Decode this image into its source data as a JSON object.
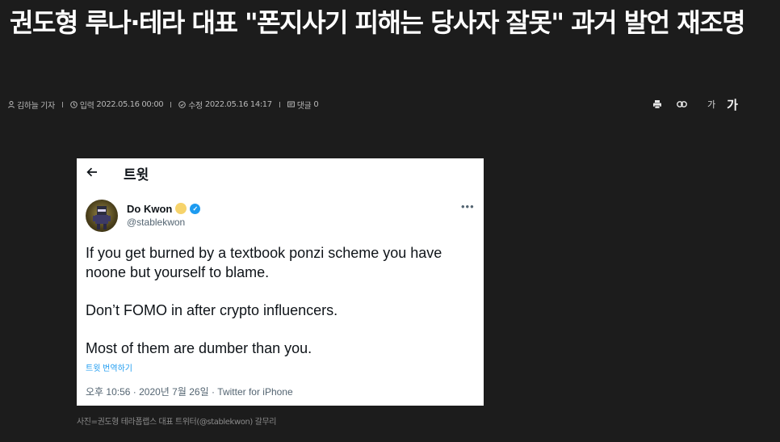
{
  "headline": "권도형 루나·테라 대표 \"폰지사기 피해는 당사자 잘못\" 과거 발언 재조명",
  "meta": {
    "author": "김하늘 기자",
    "published_label": "입력",
    "published": "2022.05.16 00:00",
    "modified_label": "수정",
    "modified": "2022.05.16 14:17",
    "comments_label": "댓글",
    "comments": "0"
  },
  "tools": {
    "font_small": "가",
    "font_large": "가"
  },
  "tweet": {
    "header_title": "트윗",
    "author_name": "Do Kwon",
    "author_handle": "@stablekwon",
    "lines": [
      "If you get burned by a textbook ponzi scheme you have noone but yourself to blame.",
      "Don’t FOMO in after crypto influencers.",
      "Most of them are dumber than you."
    ],
    "translate_label": "트윗 번역하기",
    "timestamp": "오후 10:56 · 2020년 7월 26일 · Twitter for iPhone"
  },
  "caption": "사진=권도형 테라폼랩스 대표 트위터(@stablekwon) 갈무리",
  "colors": {
    "page_background": "#1c1c1c",
    "twitter_blue": "#1d9bf0",
    "tweet_text": "#0f1419",
    "tweet_secondary": "#536471"
  }
}
